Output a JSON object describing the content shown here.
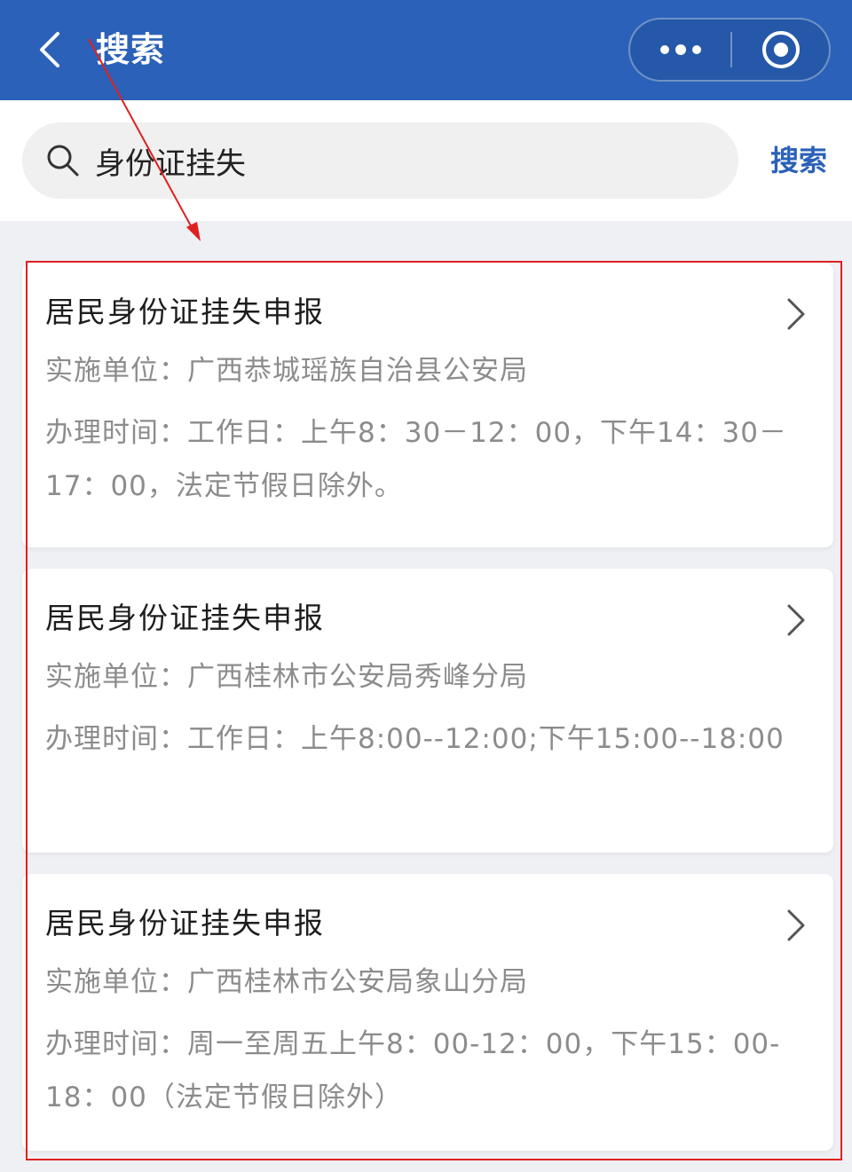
{
  "header": {
    "title": "搜索",
    "back_icon": "chevron-left-icon",
    "more_icon": "more-dots-icon",
    "close_icon": "target-close-icon"
  },
  "search": {
    "value": "身份证挂失",
    "button_label": "搜索",
    "icon": "search-icon"
  },
  "results": [
    {
      "title": "居民身份证挂失申报",
      "unit": "实施单位：广西恭城瑶族自治县公安局",
      "time": "办理时间：工作日：上午8：30－12：00，下午14：30－17：00，法定节假日除外。"
    },
    {
      "title": "居民身份证挂失申报",
      "unit": "实施单位：广西桂林市公安局秀峰分局",
      "time": "办理时间：工作日：上午8:00--12:00;下午15:00--18:00"
    },
    {
      "title": "居民身份证挂失申报",
      "unit": "实施单位：广西桂林市公安局象山分局",
      "time": "办理时间：周一至周五上午8：00-12：00，下午15：00-18：00（法定节假日除外）"
    }
  ],
  "colors": {
    "header_bg": "#2b61b8",
    "accent": "#2b61b8",
    "annotation": "#e02020"
  }
}
